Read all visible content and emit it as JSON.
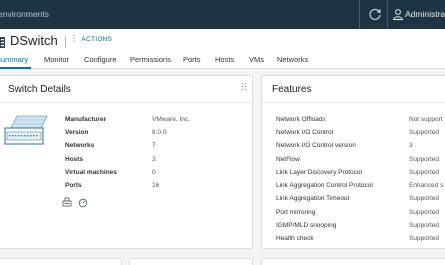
{
  "topbar": {
    "title": "environments",
    "user": "Administrat"
  },
  "header": {
    "object_name": "DSwitch",
    "actions_label": "ACTIONS",
    "tabs": [
      "Summary",
      "Monitor",
      "Configure",
      "Permissions",
      "Ports",
      "Hosts",
      "VMs",
      "Networks"
    ],
    "active_tab": "Summary"
  },
  "switch_details": {
    "title": "Switch Details",
    "rows": [
      {
        "label": "Manufacturer",
        "value": "VMware, Inc."
      },
      {
        "label": "Version",
        "value": "8.0.0"
      },
      {
        "label": "Networks",
        "value": "7"
      },
      {
        "label": "Hosts",
        "value": "3"
      },
      {
        "label": "Virtual machines",
        "value": "0"
      },
      {
        "label": "Ports",
        "value": "16"
      }
    ],
    "icons": [
      "host-network-icon",
      "speed-icon"
    ]
  },
  "features": {
    "title": "Features",
    "rows": [
      {
        "label": "Network Offloads",
        "value": "Not support"
      },
      {
        "label": "Network I/O Control",
        "value": "Supported"
      },
      {
        "label": "Network I/O Control version",
        "value": "3"
      },
      {
        "label": "NetFlow",
        "value": "Supported"
      },
      {
        "label": "Link Layer Discovery Protocol",
        "value": "Supported"
      },
      {
        "label": "Link Aggregation Control Protocol",
        "value": "Enhanced s"
      },
      {
        "label": "Link Aggregation Timeout",
        "value": "Supported"
      },
      {
        "label": "Port mirroring",
        "value": "Supported"
      },
      {
        "label": "IGMP/MLD snooping",
        "value": "Supported"
      },
      {
        "label": "Health check",
        "value": "Supported"
      }
    ]
  },
  "colors": {
    "accent": "#0072a3",
    "topbar": "#1f3443"
  }
}
